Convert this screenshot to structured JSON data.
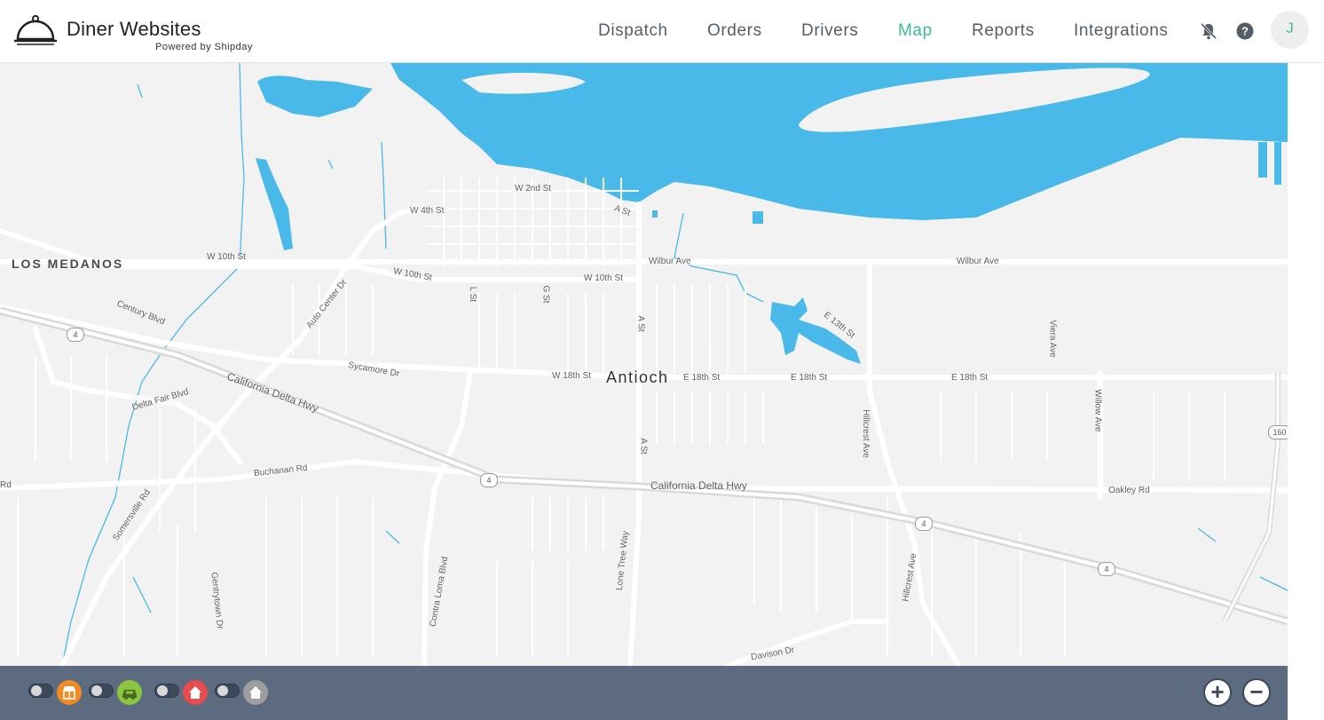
{
  "brand": {
    "title": "Diner Websites",
    "subtitle": "Powered by Shipday"
  },
  "nav": {
    "items": [
      {
        "label": "Dispatch",
        "active": false
      },
      {
        "label": "Orders",
        "active": false
      },
      {
        "label": "Drivers",
        "active": false
      },
      {
        "label": "Map",
        "active": true
      },
      {
        "label": "Reports",
        "active": false
      },
      {
        "label": "Integrations",
        "active": false
      }
    ],
    "icons": [
      "bell-off-icon",
      "help-icon"
    ],
    "avatar_initial": "J"
  },
  "colors": {
    "accent": "#3cbd8c",
    "water": "#48b9e9",
    "land": "#f2f2f2",
    "toolbar": "#5c6b80",
    "restaurant_layer": "#f08a24",
    "driver_layer": "#8cc63f",
    "customer_layer": "#e84c4c",
    "home_layer": "#9e9e9e"
  },
  "map": {
    "city": "Antioch",
    "area": "LOS MEDANOS",
    "streets": {
      "w2nd": "W 2nd St",
      "w4th": "W 4th St",
      "a_st_top": "A St",
      "w10th_left": "W 10th St",
      "w10th_mid": "W 10th St",
      "w10th_right": "W 10th St",
      "wilbur1": "Wilbur Ave",
      "wilbur2": "Wilbur Ave",
      "century": "Century Blvd",
      "auto_center": "Auto Center Dr",
      "l_st": "L St",
      "g_st": "G St",
      "a_st_mid": "A St",
      "a_st_low": "A St",
      "e13th": "E 13th St",
      "viera": "Viera Ave",
      "sycamore": "Sycamore Dr",
      "w18th": "W 18th St",
      "e18th_1": "E 18th St",
      "e18th_2": "E 18th St",
      "e18th_3": "E 18th St",
      "delta_fair": "Delta Fair Blvd",
      "cal_delta_1": "California Delta Hwy",
      "cal_delta_2": "California Delta Hwy",
      "hillcrest_1": "Hillcrest Ave",
      "hillcrest_2": "Hillcrest Ave",
      "willow": "Willow Ave",
      "buchanan": "Buchanan Rd",
      "oakley": "Oakley Rd",
      "somersville": "Somersville Rd",
      "contra_loma": "Contra Loma Blvd",
      "lone_tree": "Lone Tree Way",
      "gentrytown": "Gentrytown Dr",
      "davison": "Davison Dr",
      "edge_rd": "Rd"
    },
    "shields": [
      "4",
      "4",
      "4",
      "4",
      "160"
    ]
  },
  "toolbar": {
    "layers": [
      {
        "name": "restaurants",
        "icon": "store-icon",
        "enabled": false
      },
      {
        "name": "drivers",
        "icon": "car-icon",
        "enabled": false
      },
      {
        "name": "customers",
        "icon": "home-icon",
        "enabled": false
      },
      {
        "name": "home",
        "icon": "home-icon",
        "enabled": false
      }
    ],
    "zoom_in": "+",
    "zoom_out": "−"
  }
}
